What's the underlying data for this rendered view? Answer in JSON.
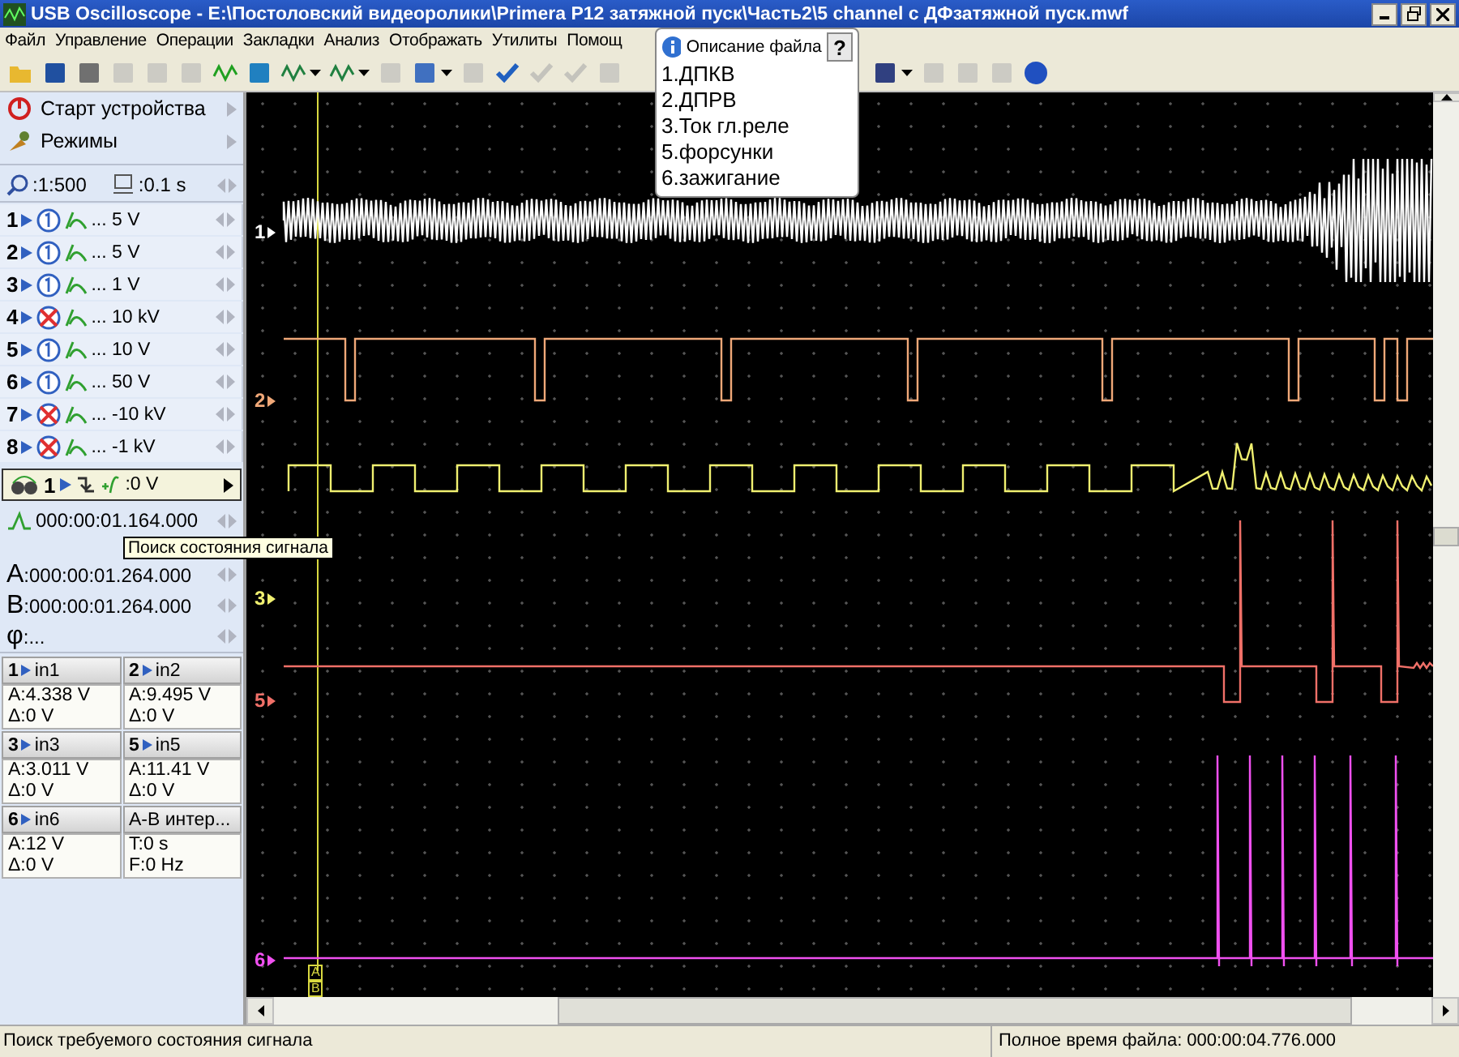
{
  "window": {
    "title": "USB Oscilloscope - E:\\Постоловский видеоролики\\Primera P12 затяжной пуск\\Часть2\\5 channel с ДФзатяжной пуск.mwf"
  },
  "menu": [
    "Файл",
    "Управление",
    "Операции",
    "Закладки",
    "Анализ",
    "Отображать",
    "Утилиты",
    "Помощ"
  ],
  "toolbar": [
    {
      "kind": "open",
      "disabled": false
    },
    {
      "kind": "save",
      "disabled": false
    },
    {
      "kind": "print",
      "disabled": false
    },
    {
      "kind": "copy",
      "disabled": true
    },
    {
      "kind": "copy",
      "disabled": true
    },
    {
      "kind": "export",
      "disabled": true
    },
    {
      "kind": "trigger",
      "disabled": false
    },
    {
      "kind": "probe",
      "disabled": false
    },
    {
      "kind": "wave",
      "disabled": false,
      "dropdown": true
    },
    {
      "kind": "wave",
      "disabled": false,
      "dropdown": true
    },
    {
      "kind": "undo",
      "disabled": true
    },
    {
      "kind": "display",
      "disabled": false,
      "dropdown": true
    },
    {
      "kind": "marker",
      "disabled": true
    },
    {
      "kind": "check",
      "disabled": false
    },
    {
      "kind": "check",
      "disabled": true
    },
    {
      "kind": "check",
      "disabled": true
    },
    {
      "kind": "page",
      "disabled": true
    },
    {
      "kind": "table",
      "disabled": false,
      "dropdown": true
    },
    {
      "kind": "chart",
      "disabled": true
    },
    {
      "kind": "page",
      "disabled": true
    },
    {
      "kind": "erase",
      "disabled": true
    },
    {
      "kind": "help",
      "disabled": false
    }
  ],
  "sidebar": {
    "actions": [
      {
        "kind": "power",
        "label": "Старт устройства"
      },
      {
        "kind": "modes",
        "label": "Режимы"
      }
    ],
    "zoom": ":1:500",
    "timebase": ":0.1 s",
    "channels": [
      {
        "number": "1",
        "enabled": true,
        "range": "... 5 V"
      },
      {
        "number": "2",
        "enabled": true,
        "range": "... 5 V"
      },
      {
        "number": "3",
        "enabled": true,
        "range": "... 1 V"
      },
      {
        "number": "4",
        "enabled": false,
        "range": "... 10 kV"
      },
      {
        "number": "5",
        "enabled": true,
        "range": "... 10 V"
      },
      {
        "number": "6",
        "enabled": true,
        "range": "... 50 V"
      },
      {
        "number": "7",
        "enabled": false,
        "range": "... -10 kV"
      },
      {
        "number": "8",
        "enabled": false,
        "range": "... -1 kV"
      }
    ],
    "trigger": {
      "channel": "1",
      "level": ":0 V"
    },
    "trigger_time": "000:00:01.164.000",
    "cursors": [
      {
        "label": "A",
        "time": ":000:00:01.264.000"
      },
      {
        "label": "B",
        "time": ":000:00:01.264.000"
      },
      {
        "label": "φ",
        "time": ":..."
      }
    ],
    "measurements": [
      {
        "kind": "channel",
        "number": "1",
        "name": "in1",
        "lines": [
          "A:4.338 V",
          "Δ:0 V"
        ]
      },
      {
        "kind": "channel",
        "number": "2",
        "name": "in2",
        "lines": [
          "A:9.495 V",
          "Δ:0 V"
        ]
      },
      {
        "kind": "channel",
        "number": "3",
        "name": "in3",
        "lines": [
          "A:3.011 V",
          "Δ:0 V"
        ]
      },
      {
        "kind": "channel",
        "number": "5",
        "name": "in5",
        "lines": [
          "A:11.41 V",
          "Δ:0 V"
        ]
      },
      {
        "kind": "channel",
        "number": "6",
        "name": "in6",
        "lines": [
          "A:12 V",
          "Δ:0 V"
        ]
      },
      {
        "kind": "interval",
        "name": "A-B интер...",
        "lines": [
          "T:0 s",
          "F:0 Hz"
        ]
      }
    ]
  },
  "tooltip": "Поиск состояния сигнала",
  "traces": [
    {
      "label": "1",
      "color": "#ffffff",
      "kind": "noise"
    },
    {
      "label": "2",
      "color": "#f0a878",
      "kind": "pulses"
    },
    {
      "label": "3",
      "color": "#f0f070",
      "kind": "square"
    },
    {
      "label": "5",
      "color": "#f07068",
      "kind": "spikes"
    },
    {
      "label": "6",
      "color": "#f050f0",
      "kind": "ignition"
    }
  ],
  "cursor_labels": [
    "A",
    "B"
  ],
  "file_description": {
    "title": "Описание файла",
    "help": "?",
    "lines": [
      "1.ДПКВ",
      "2.ДПРВ",
      "3.Ток гл.реле",
      "5.форсунки",
      "6.зажигание"
    ]
  },
  "status_bar": {
    "left": "Поиск требуемого состояния сигнала",
    "right": "Полное время файла: 000:00:04.776.000"
  }
}
